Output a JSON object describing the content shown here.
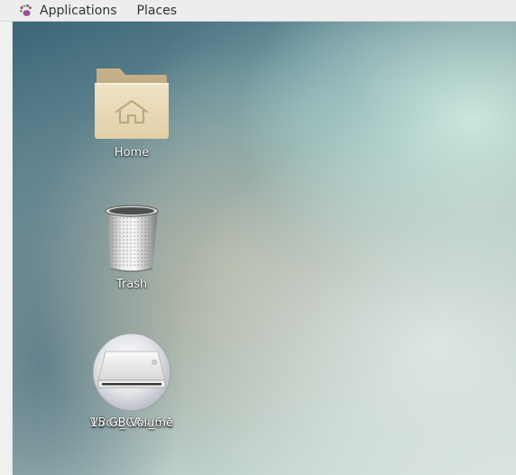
{
  "topbar": {
    "logo_icon": "gnome-foot-icon",
    "applications_label": "Applications",
    "places_label": "Places"
  },
  "desktop": {
    "icons": [
      {
        "label": "Home",
        "icon": "home-folder-icon"
      },
      {
        "label": "Trash",
        "icon": "trash-icon"
      },
      {
        "labels": [
          "VBox_GAs_6.1",
          "15 GB Volume"
        ],
        "icon": "optical-drive-icon"
      }
    ]
  }
}
